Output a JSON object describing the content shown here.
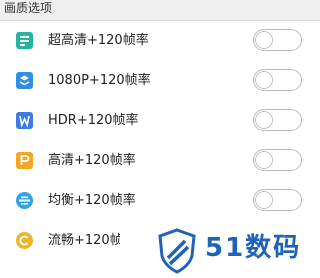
{
  "header": {
    "title": "画质选项"
  },
  "items": [
    {
      "label": "超高清+120帧率",
      "icon": "ultra-hd-icon",
      "color": "#22b6a0",
      "on": false
    },
    {
      "label": "1080P+120帧率",
      "icon": "1080p-icon",
      "color": "#2f8fe6",
      "on": false
    },
    {
      "label": "HDR+120帧率",
      "icon": "hdr-icon",
      "color": "#3c7be0",
      "on": false
    },
    {
      "label": "高清+120帧率",
      "icon": "hd-icon",
      "color": "#f5a623",
      "on": false
    },
    {
      "label": "均衡+120帧率",
      "icon": "balanced-icon",
      "color": "#2fa4e7",
      "on": false
    },
    {
      "label": "流畅+120帧率",
      "icon": "smooth-icon",
      "color": "#f0b429",
      "on": false
    }
  ],
  "watermark": {
    "text": "51数码",
    "color": "#1e63b8"
  }
}
